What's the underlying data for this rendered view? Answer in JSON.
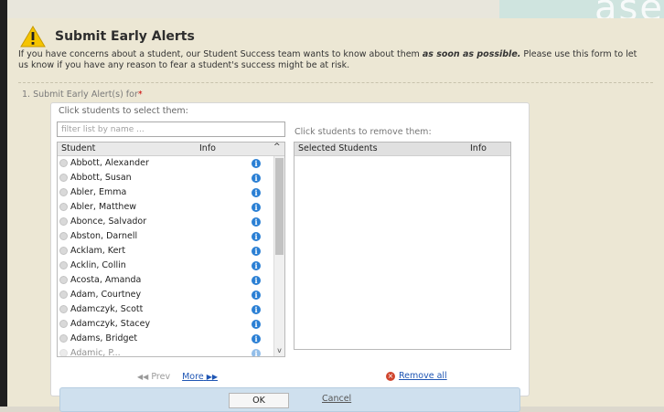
{
  "header": {
    "title": "Submit Early Alerts",
    "banner_text": "ase"
  },
  "intro": {
    "text_before": "If you have concerns about a student, our Student Success team wants to know about them ",
    "emphasis": "as soon as possible.",
    "text_after": " Please use this form to let us know if you have any reason to fear a student's success might be at risk."
  },
  "question": {
    "label": "1. Submit Early Alert(s) for",
    "required_marker": "*"
  },
  "picker": {
    "select_hint": "Click students to select them:",
    "filter_placeholder": "filter list by name ...",
    "remove_hint": "Click students to remove them:",
    "list_columns": {
      "student": "Student",
      "info": "Info"
    },
    "selected_columns": {
      "student": "Selected Students",
      "info": "Info"
    },
    "info_glyph": "i",
    "sort_glyph": "^",
    "scroll_down_glyph": "v",
    "students": [
      "Abbott, Alexander",
      "Abbott, Susan",
      "Abler, Emma",
      "Abler, Matthew",
      "Abonce, Salvador",
      "Abston, Darnell",
      "Acklam, Kert",
      "Acklin, Collin",
      "Acosta, Amanda",
      "Adam, Courtney",
      "Adamczyk, Scott",
      "Adamczyk, Stacey",
      "Adams, Bridget",
      "Adamic, P..."
    ],
    "selected_students": [],
    "pager": {
      "prev": "Prev",
      "more": "More",
      "prev_arrow": "◀◀",
      "next_arrow": "▶▶"
    },
    "remove_all": "Remove all",
    "remove_icon_glyph": "×"
  },
  "actions": {
    "ok_label": "OK",
    "cancel_label": "Cancel"
  },
  "colors": {
    "accent_link": "#1f56b4",
    "info_icon": "#2a7fd4",
    "warning_icon": "#f5c400",
    "remove_icon": "#d0452d",
    "required": "#cc0000"
  }
}
